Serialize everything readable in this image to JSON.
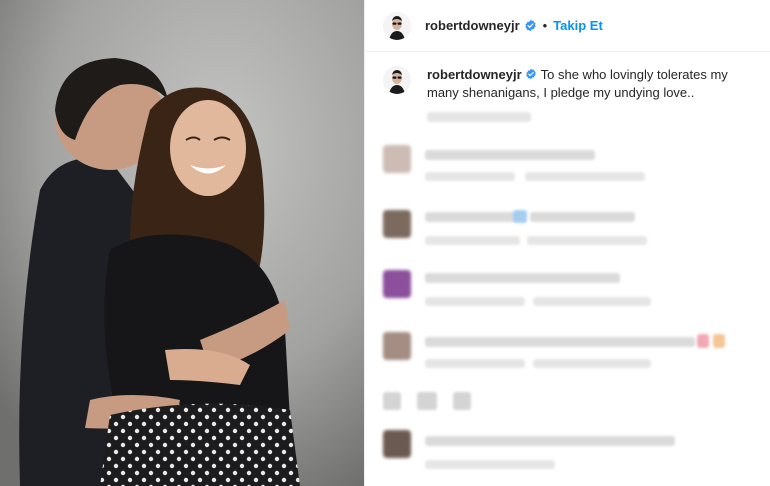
{
  "post": {
    "username": "robertdowneyjr",
    "follow_label": "Takip Et",
    "separator": "•",
    "caption": "To she who lovingly tolerates my many shenanigans, I pledge my undying love.."
  },
  "icons": {
    "verified": "verified-badge-icon",
    "avatar": "profile-avatar"
  },
  "colors": {
    "follow": "#0095f6",
    "verified": "#3897f0",
    "text": "#262626"
  }
}
